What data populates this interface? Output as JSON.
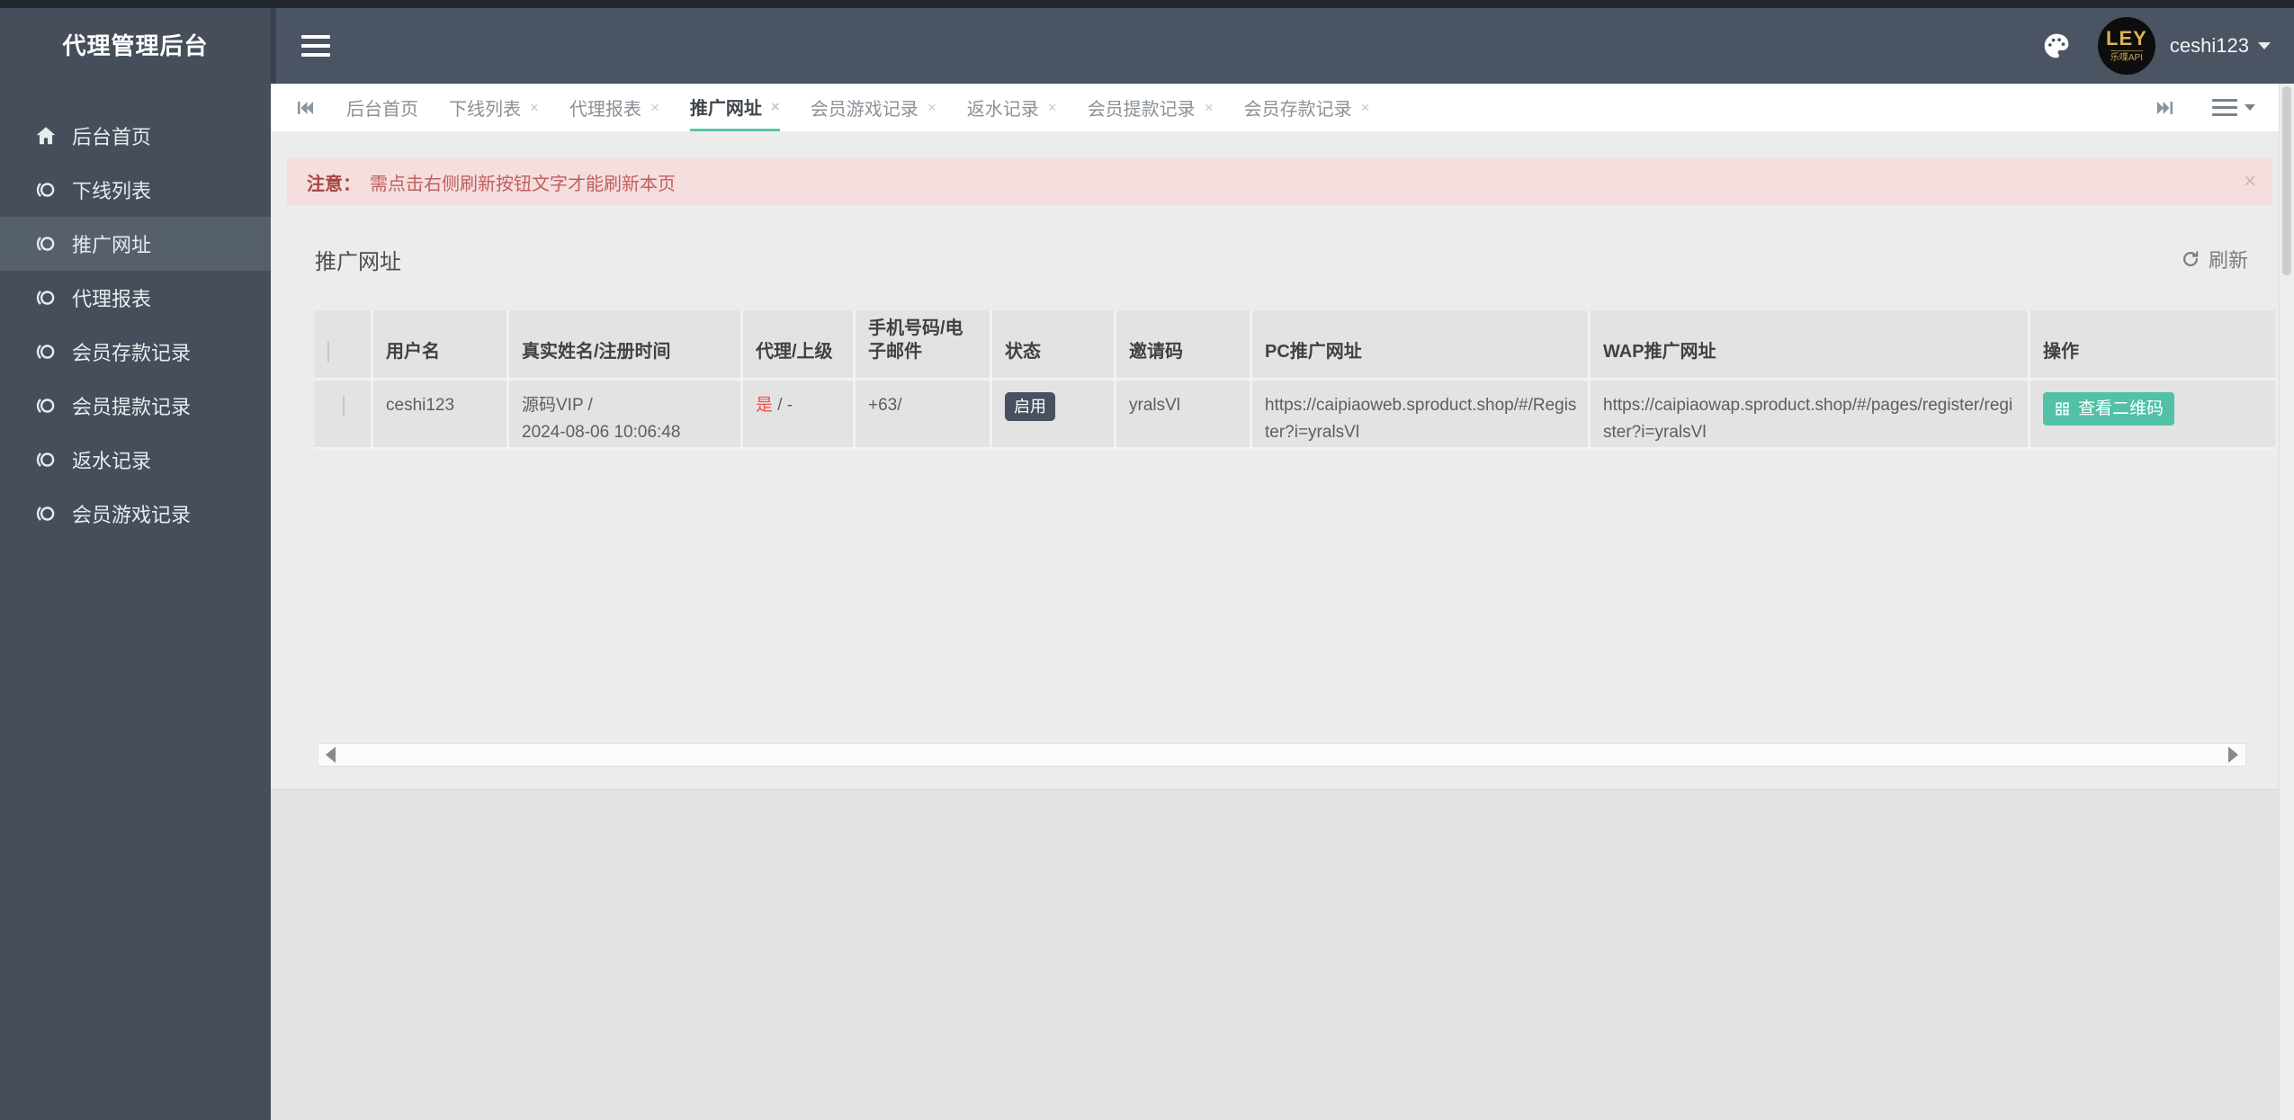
{
  "app": {
    "title": "代理管理后台"
  },
  "topbar": {
    "username": "ceshi123",
    "avatar_line1": "LEY",
    "avatar_line2": "乐喋API"
  },
  "sidebar": {
    "items": [
      {
        "label": "后台首页"
      },
      {
        "label": "下线列表"
      },
      {
        "label": "推广网址"
      },
      {
        "label": "代理报表"
      },
      {
        "label": "会员存款记录"
      },
      {
        "label": "会员提款记录"
      },
      {
        "label": "返水记录"
      },
      {
        "label": "会员游戏记录"
      }
    ]
  },
  "tabs": [
    {
      "label": "后台首页"
    },
    {
      "label": "下线列表"
    },
    {
      "label": "代理报表"
    },
    {
      "label": "推广网址"
    },
    {
      "label": "会员游戏记录"
    },
    {
      "label": "返水记录"
    },
    {
      "label": "会员提款记录"
    },
    {
      "label": "会员存款记录"
    }
  ],
  "ui": {
    "close_x": "×"
  },
  "notice": {
    "prefix": "注意：",
    "text": "需点击右侧刷新按钮文字才能刷新本页",
    "close": "×"
  },
  "panel": {
    "title": "推广网址",
    "refresh": "刷新"
  },
  "table": {
    "headers": [
      "用户名",
      "真实姓名/注册时间",
      "代理/上级",
      "手机号码/电子邮件",
      "状态",
      "邀请码",
      "PC推广网址",
      "WAP推广网址",
      "操作"
    ],
    "row": {
      "username": "ceshi123",
      "realname": "源码VIP /",
      "register_time": "2024-08-06 10:06:48",
      "agent_flag": "是",
      "agent_rest": " / -",
      "phone": "+63/",
      "status": "启用",
      "invite_code": "yralsVl",
      "pc_url": "https://caipiaoweb.sproduct.shop/#/Register?i=yralsVl",
      "wap_url": "https://caipiaowap.sproduct.shop/#/pages/register/register?i=yralsVl",
      "action": "查看二维码"
    }
  },
  "colors": {
    "accent_teal": "#53c0a8",
    "danger_text": "#c25e5e",
    "badge_bg": "#475160",
    "sidebar_bg": "#454e5a"
  }
}
